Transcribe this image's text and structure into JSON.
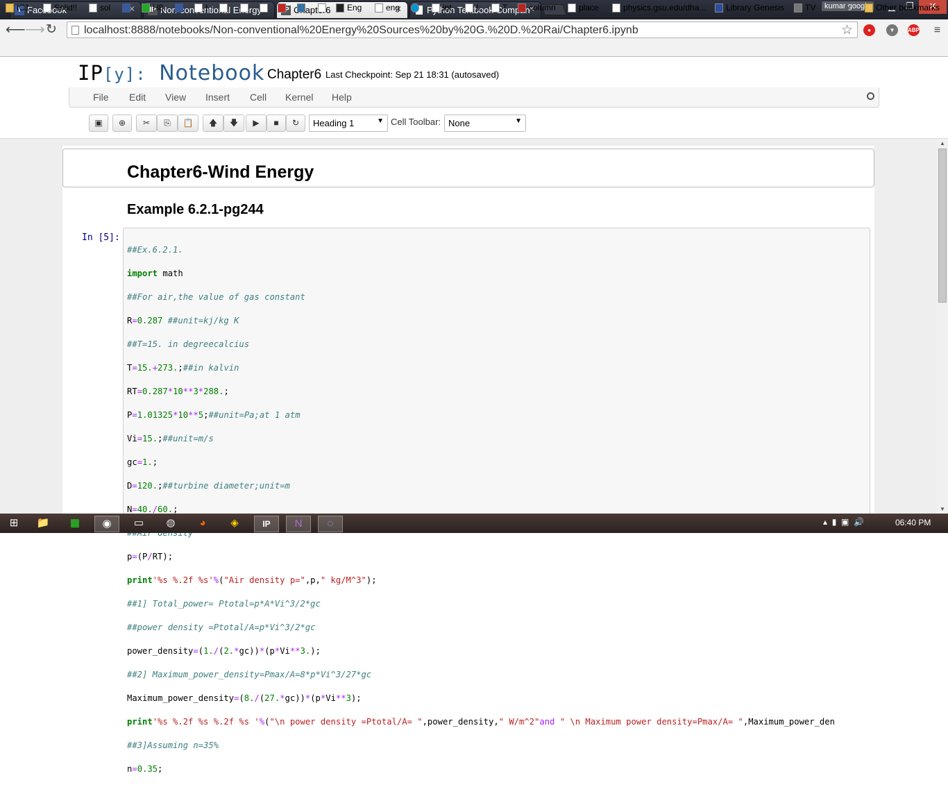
{
  "browser": {
    "tabs": [
      {
        "title": "Facebook",
        "icon": "facebook-icon"
      },
      {
        "title": "Non-conventional Energy",
        "icon": "ipython-icon"
      },
      {
        "title": "Chapter6",
        "icon": "ipython-icon"
      },
      {
        "title": "Python Textbook Compan",
        "icon": "page-icon"
      }
    ],
    "user": "kumar google",
    "url": "localhost:8888/notebooks/Non-conventional%20Energy%20Sources%20by%20G.%20D.%20Rai/Chapter6.ipynb",
    "bookmarks": [
      "IC1",
      "Solid!!",
      "sol",
      "H8",
      "I",
      "Eng",
      "eng",
      "int",
      "L",
      "T",
      "column",
      "place",
      "physics.gsu.edu/dha...",
      "Library Genesis",
      "TV",
      "Other bookmarks"
    ],
    "bookmarks_overflow": "»"
  },
  "notebook": {
    "logo_ip": "IP",
    "logo_y": "[y]:",
    "logo_name": "Notebook",
    "name": "Chapter6",
    "checkpoint": "Last Checkpoint: Sep 21 18:31 (autosaved)",
    "menu": [
      "File",
      "Edit",
      "View",
      "Insert",
      "Cell",
      "Kernel",
      "Help"
    ],
    "cell_type": "Heading 1",
    "cell_toolbar_label": "Cell Toolbar:",
    "cell_toolbar_value": "None"
  },
  "cells": {
    "heading1": "Chapter6-Wind Energy",
    "heading2": "Example 6.2.1-pg244",
    "prompt": "In [5]:"
  },
  "code_lines": [
    "##Ex.6.2.1.",
    "import math",
    "##For air,the value of gas constant",
    "R=0.287 ##unit=kj/kg K",
    "##T=15. in degreecalcius",
    "T=15.+273.;##in kalvin",
    "RT=0.287*10**3*288.;",
    "P=1.01325*10**5;##unit=Pa;at 1 atm",
    "Vi=15.;##unit=m/s",
    "gc=1.;",
    "D=120.;##turbine diameter;unit=m",
    "N=40./60.;",
    "##Air density",
    "p=(P/RT);",
    "print'%s %.2f %s'%(\"Air density p=\",p,\" kg/M^3\");",
    "##1] Total_power= Ptotal=p*A*Vi^3/2*gc",
    "##power density =Ptotal/A=p*Vi^3/2*gc",
    "power_density=(1./(2.*gc))*(p*Vi**3.);",
    "##2] Maximum_power_density=Pmax/A=8*p*Vi^3/27*gc",
    "Maximum_power_density=(8./(27.*gc))*(p*Vi**3);",
    "print'%s %.2f %s %.2f %s '%(\"\\n power density =Ptotal/A= \",power_density,\" W/m^2\"and \" \\n Maximum power density=Pmax/A= \",Maximum_power_den",
    "##3]Assuming n=35%",
    "n=0.35;",
    "..."
  ],
  "taskbar": {
    "clock": "06:40 PM"
  }
}
